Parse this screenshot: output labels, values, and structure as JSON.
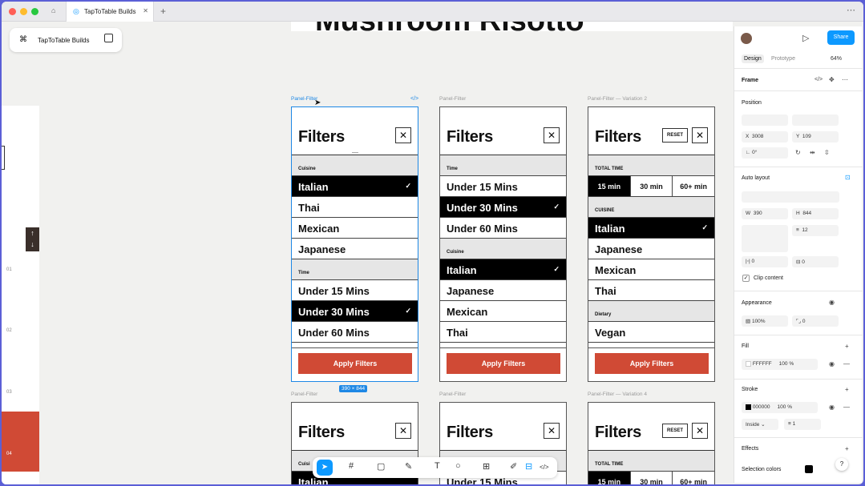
{
  "tab": {
    "title": "TapToTable Builds"
  },
  "project": {
    "name": "TapToTable Builds"
  },
  "canvas": {
    "big_heading": "Mushroom Risotto",
    "frame_size": "390 × 844",
    "labels": [
      "Panel-Filter",
      "Panel-Filter",
      "Panel-Filter — Variation 2",
      "Panel-Filter",
      "Panel-Filter",
      "Panel-Filter — Variation 4"
    ],
    "left_numbers": [
      "01",
      "02",
      "03",
      "04"
    ]
  },
  "panels": {
    "title": "Filters",
    "close": "✕",
    "reset": "RESET",
    "apply": "Apply Filters",
    "check": "✓",
    "p1": {
      "sec1": "Cuisine",
      "sec1_items": [
        "Italian",
        "Thai",
        "Mexican",
        "Japanese"
      ],
      "sec2": "Time",
      "sec2_items": [
        "Under 15 Mins",
        "Under 30 Mins",
        "Under 60 Mins"
      ]
    },
    "p2": {
      "sec1": "Time",
      "sec1_items": [
        "Under 15 Mins",
        "Under 30 Mins",
        "Under 60 Mins"
      ],
      "sec2": "Cuisine",
      "sec2_items": [
        "Italian",
        "Japanese",
        "Mexican",
        "Thai"
      ]
    },
    "p3": {
      "sec1": "TOTAL TIME",
      "seg": [
        "15 min",
        "30 min",
        "60+ min"
      ],
      "sec2": "CUISINE",
      "sec2_items": [
        "Italian",
        "Japanese",
        "Mexican",
        "Thai"
      ],
      "sec3": "Dietary",
      "sec3_items": [
        "Vegan"
      ]
    },
    "row2": {
      "p1_sec": "Cuisi",
      "p1_item": "Italian",
      "p2_item": "Under 15 Mins",
      "p3_sec": "TOTAL TIME",
      "p3_seg": [
        "15 min",
        "30 min",
        "60+ min"
      ]
    }
  },
  "right_panel": {
    "share": "Share",
    "tabs": [
      "Design",
      "Prototype"
    ],
    "zoom": "64%",
    "frame": "Frame",
    "position": "Position",
    "x": "3008",
    "y": "109",
    "rotation": "0°",
    "auto_layout": "Auto layout",
    "w": "390",
    "h": "844",
    "gap": "12",
    "pad_h": "0",
    "pad_v": "0",
    "clip": "Clip content",
    "appearance": "Appearance",
    "opacity": "100%",
    "radius": "0",
    "fill": "Fill",
    "fill_hex": "FFFFFF",
    "fill_pct": "100",
    "stroke": "Stroke",
    "stroke_hex": "000000",
    "stroke_pct": "100",
    "stroke_pos": "Inside",
    "stroke_w": "1",
    "effects": "Effects",
    "selection_colors": "Selection colors",
    "help": "?"
  },
  "colors": {
    "accent": "#d04a35",
    "figma_blue": "#0d99ff",
    "selection": "#1e88e5"
  }
}
